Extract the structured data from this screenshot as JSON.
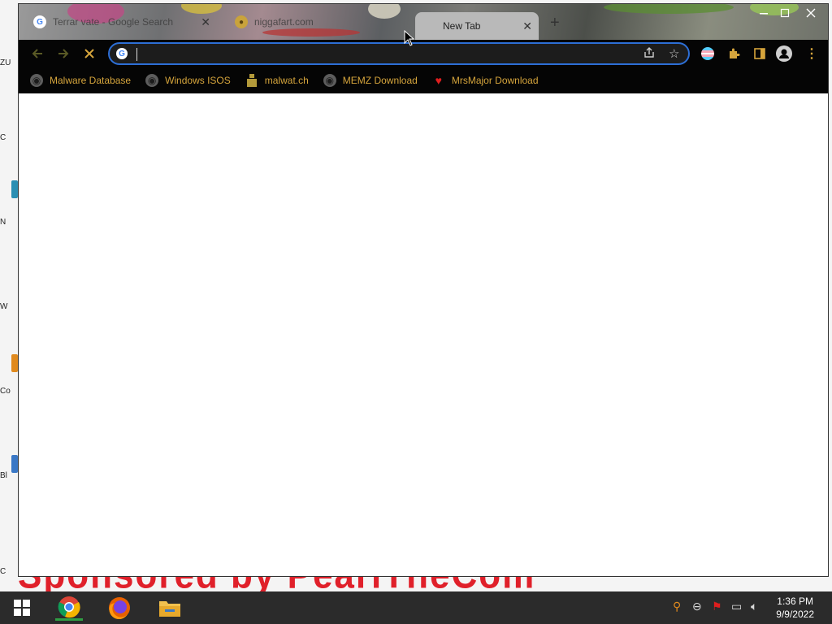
{
  "browser": {
    "tabs": [
      {
        "title": "Terrar vate - Google Search",
        "active": false
      },
      {
        "title": "niggafart.com",
        "active": false
      },
      {
        "title": "New Tab",
        "active": true
      }
    ],
    "new_tab_symbol": "+",
    "window_controls": [
      "minimize",
      "maximize",
      "close"
    ],
    "nav": {
      "back_icon": "arrow-left-icon",
      "forward_icon": "arrow-right-icon",
      "stop_icon": "stop-loading-icon"
    },
    "omnibox": {
      "value": "",
      "placeholder": ""
    },
    "bookmarks": [
      {
        "label": "Malware Database",
        "icon": "globe-icon"
      },
      {
        "label": "Windows ISOS",
        "icon": "globe-icon"
      },
      {
        "label": "malwat.ch",
        "icon": "malwatch-icon"
      },
      {
        "label": "MEMZ Download",
        "icon": "globe-icon"
      },
      {
        "label": "MrsMajor Download",
        "icon": "heart-icon"
      }
    ]
  },
  "desktop": {
    "banner_text": "Sponsored by PeariTheCom",
    "edge_labels": [
      "ZU",
      "C",
      "N",
      "W",
      "Co",
      "Bl",
      "C"
    ]
  },
  "taskbar": {
    "apps": [
      "start-button",
      "chrome-icon",
      "firefox-icon",
      "file-explorer-icon"
    ],
    "time": "1:36 PM",
    "date": "9/9/2022"
  },
  "colors": {
    "bookmark_text": "#d6a53c",
    "toolbar_bg": "#050505",
    "omnibox_focus": "#2d6fd6",
    "taskbar_bg": "#2b2b2b"
  }
}
